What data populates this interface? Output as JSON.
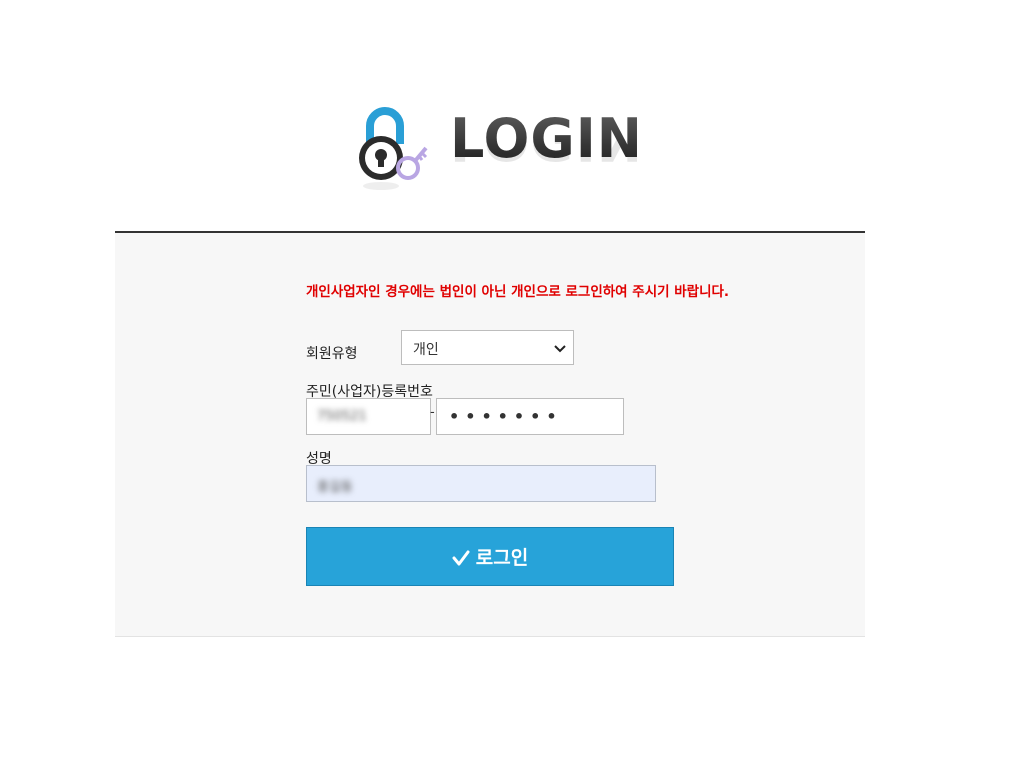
{
  "logo": {
    "text": "LOGIN",
    "icon": "padlock-key-icon"
  },
  "form": {
    "notice": "개인사업자인 경우에는 법인이 아닌 개인으로 로그인하여 주시기 바랍니다.",
    "member_type_label": "회원유형",
    "member_type_value": "개인",
    "registration_label": "주민(사업자)등록번호",
    "registration_first_value": "750521",
    "registration_separator": "-",
    "registration_second_value": "•••••••",
    "name_label": "성명",
    "name_value": "홍길동",
    "login_button_label": "로그인"
  },
  "colors": {
    "notice": "#e00000",
    "button": "#27a3d9",
    "panel": "#f7f7f7",
    "lock_shackle": "#2a9fd6",
    "key": "#b9a6e3"
  }
}
